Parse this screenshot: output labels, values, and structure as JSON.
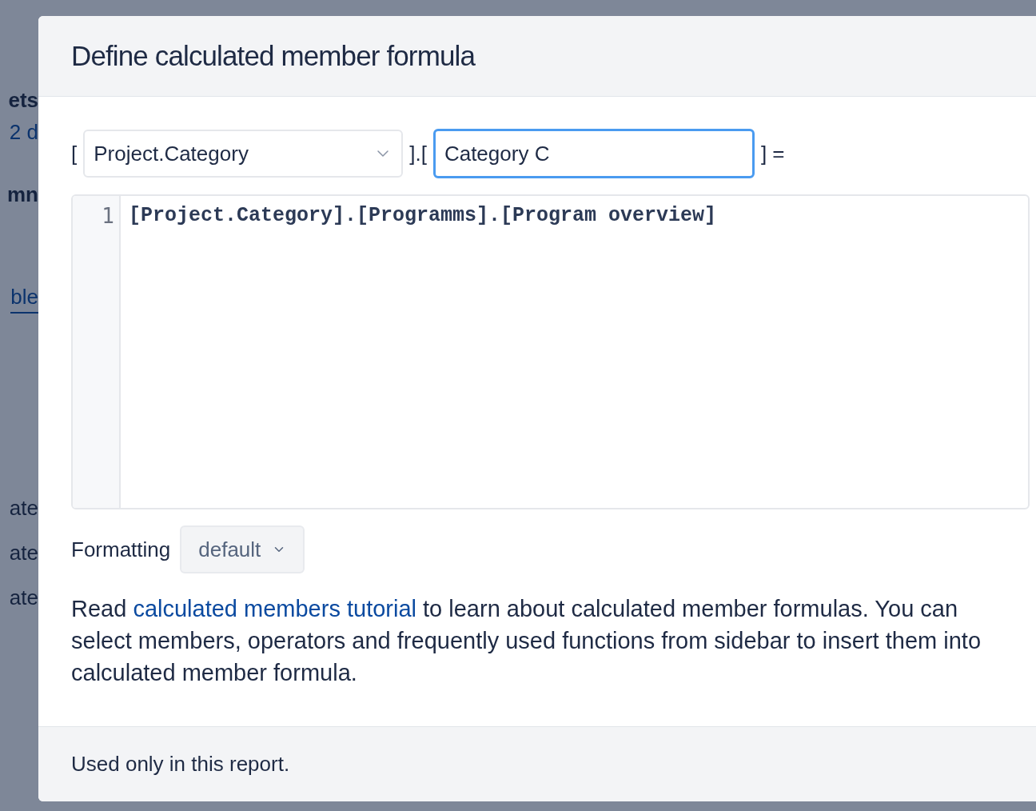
{
  "background": {
    "texts": [
      {
        "text": "ets",
        "kind": "label"
      },
      {
        "text": "2 d",
        "kind": "link"
      },
      {
        "text": "mn",
        "kind": "label"
      },
      {
        "text": "ble",
        "kind": "tab"
      },
      {
        "text": "ate",
        "kind": "row"
      },
      {
        "text": "ate",
        "kind": "row"
      },
      {
        "text": "ate",
        "kind": "row"
      }
    ]
  },
  "dialog": {
    "title": "Define calculated member formula",
    "dimension": {
      "open": "[",
      "value": "Project.Category",
      "separator": "].[",
      "member": "Category C",
      "member_focused": true,
      "close": "] ="
    },
    "editor": {
      "lines": [
        {
          "number": "1",
          "code": "[Project.Category].[Programms].[Program overview]"
        }
      ]
    },
    "formatting": {
      "label": "Formatting",
      "value": "default"
    },
    "help": {
      "before": "Read ",
      "link": "calculated members tutorial",
      "after": " to learn about calculated member formulas. You can select members, operators and frequently used functions from sidebar to insert them into calculated member formula."
    },
    "footer": "Used only in this report."
  }
}
